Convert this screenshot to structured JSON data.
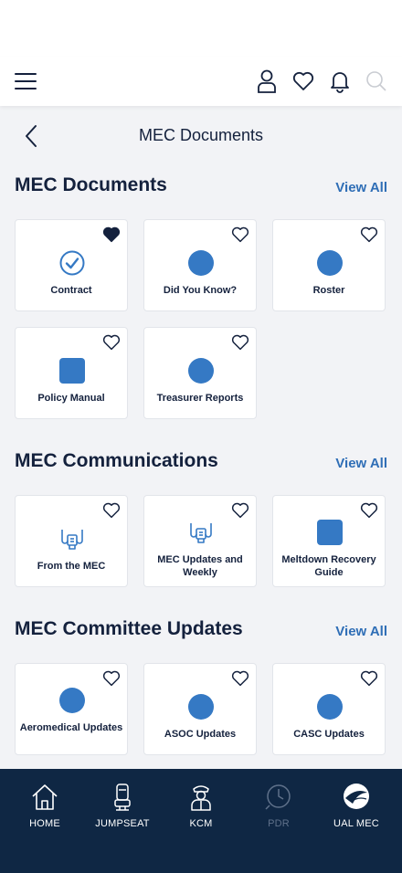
{
  "page": {
    "title": "MEC Documents"
  },
  "colors": {
    "navy": "#0f2744",
    "accent": "#2f6eb6",
    "icon_blue": "#3579c4",
    "background": "#f2f3f6"
  },
  "header": {
    "icons": [
      "menu-icon",
      "profile-icon",
      "heart-icon",
      "bell-icon",
      "search-icon"
    ]
  },
  "sections": [
    {
      "title": "MEC Documents",
      "view_all": "View All",
      "cards": [
        {
          "label": "Contract",
          "icon": "check-circle-icon",
          "favorited": true
        },
        {
          "label": "Did You Know?",
          "icon": "circle-icon",
          "favorited": false
        },
        {
          "label": "Roster",
          "icon": "circle-icon",
          "favorited": false
        },
        {
          "label": "Policy Manual",
          "icon": "square-icon",
          "favorited": false
        },
        {
          "label": "Treasurer Reports",
          "icon": "circle-icon",
          "favorited": false
        }
      ]
    },
    {
      "title": "MEC Communications",
      "view_all": "View All",
      "cards": [
        {
          "label": "From the MEC",
          "icon": "megaphone-icon",
          "favorited": false
        },
        {
          "label": "MEC Updates and Weekly",
          "icon": "megaphone-icon",
          "favorited": false
        },
        {
          "label": "Meltdown Recovery Guide",
          "icon": "square-icon",
          "favorited": false
        }
      ]
    },
    {
      "title": "MEC Committee Updates",
      "view_all": "View All",
      "cards": [
        {
          "label": "Aeromedical Updates",
          "icon": "circle-icon",
          "favorited": false
        },
        {
          "label": "ASOC Updates",
          "icon": "circle-icon",
          "favorited": false
        },
        {
          "label": "CASC Updates",
          "icon": "circle-icon",
          "favorited": false
        }
      ]
    }
  ],
  "bottom_nav": [
    {
      "label": "HOME",
      "icon": "home-icon",
      "enabled": true
    },
    {
      "label": "JUMPSEAT",
      "icon": "jumpseat-icon",
      "enabled": true
    },
    {
      "label": "KCM",
      "icon": "pilot-icon",
      "enabled": true
    },
    {
      "label": "PDR",
      "icon": "globe-clock-icon",
      "enabled": false
    },
    {
      "label": "UAL MEC",
      "icon": "alpa-logo-icon",
      "enabled": true
    }
  ]
}
